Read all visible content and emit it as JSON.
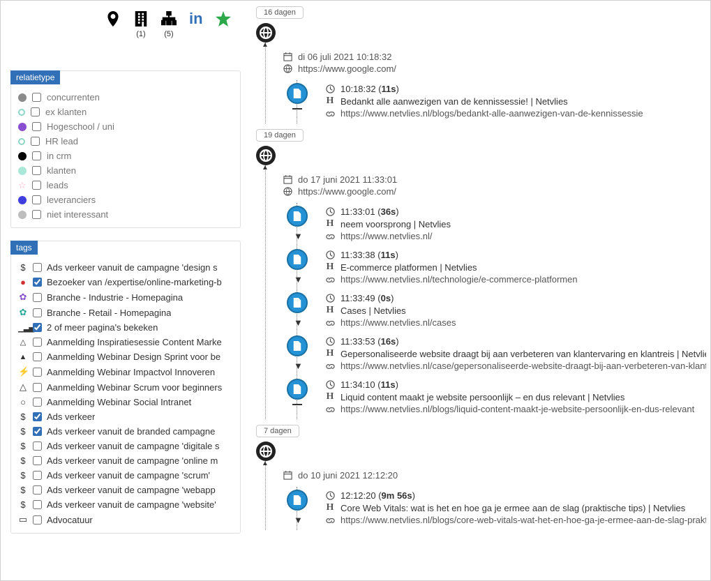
{
  "topIcons": {
    "marker": "",
    "building": {
      "count": "(1)"
    },
    "sitemap": {
      "count": "(5)"
    },
    "linkedin": "",
    "star": ""
  },
  "panels": {
    "relatietype": {
      "title": "relatietype",
      "items": [
        {
          "color": "#8a8a8a",
          "style": "solid",
          "label": "concurrenten"
        },
        {
          "color": "#8ed6c6",
          "style": "open",
          "label": "ex klanten"
        },
        {
          "color": "#8a4fd0",
          "style": "solid",
          "label": "Hogeschool / uni"
        },
        {
          "color": "#8ed6c6",
          "style": "open",
          "label": "HR lead"
        },
        {
          "color": "#000000",
          "style": "solid",
          "label": "in crm"
        },
        {
          "color": "#a9e8d8",
          "style": "solid",
          "label": "klanten"
        },
        {
          "color": "",
          "style": "star",
          "label": "leads"
        },
        {
          "color": "#3f3fe0",
          "style": "solid",
          "label": "leveranciers"
        },
        {
          "color": "#bdbdbd",
          "style": "solid",
          "label": "niet interessant"
        }
      ]
    },
    "tags": {
      "title": "tags",
      "items": [
        {
          "icon": "dollar",
          "checked": false,
          "label": "Ads verkeer vanuit de campagne 'design s"
        },
        {
          "icon": "reddot",
          "checked": true,
          "label": "Bezoeker van /expertise/online-marketing-b"
        },
        {
          "icon": "cogs-purple",
          "checked": false,
          "label": "Branche - Industrie - Homepagina"
        },
        {
          "icon": "cogs-teal",
          "checked": false,
          "label": "Branche - Retail - Homepagina"
        },
        {
          "icon": "chart",
          "checked": true,
          "label": "2 of meer pagina's bekeken"
        },
        {
          "icon": "bell-open",
          "checked": false,
          "label": "Aanmelding Inspiratiesessie Content Marke"
        },
        {
          "icon": "bell",
          "checked": false,
          "label": "Aanmelding Webinar Design Sprint voor be"
        },
        {
          "icon": "bolt",
          "checked": false,
          "label": "Aanmelding Webinar Impactvol Innoveren"
        },
        {
          "icon": "triangle",
          "checked": false,
          "label": "Aanmelding Webinar Scrum voor beginners"
        },
        {
          "icon": "circle-open",
          "checked": false,
          "label": "Aanmelding Webinar Social Intranet"
        },
        {
          "icon": "dollar",
          "checked": true,
          "label": "Ads verkeer"
        },
        {
          "icon": "dollar",
          "checked": true,
          "label": "Ads verkeer vanuit de branded campagne"
        },
        {
          "icon": "dollar",
          "checked": false,
          "label": "Ads verkeer vanuit de campagne 'digitale s"
        },
        {
          "icon": "dollar",
          "checked": false,
          "label": "Ads verkeer vanuit de campagne 'online m"
        },
        {
          "icon": "dollar",
          "checked": false,
          "label": "Ads verkeer vanuit de campagne 'scrum'"
        },
        {
          "icon": "dollar",
          "checked": false,
          "label": "Ads verkeer vanuit de campagne 'webapp"
        },
        {
          "icon": "dollar",
          "checked": false,
          "label": "Ads verkeer vanuit de campagne 'website'"
        },
        {
          "icon": "book",
          "checked": false,
          "label": "Advocatuur"
        }
      ]
    }
  },
  "timeline": [
    {
      "daysAgo": "16 dagen",
      "sourceDate": "di 06 juli 2021 10:18:32",
      "sourceUrl": "https://www.google.com/",
      "visits": [
        {
          "time": "10:18:32",
          "duration": "11s",
          "title": "Bedankt alle aanwezigen van de kennissessie! | Netvlies",
          "url": "https://www.netvlies.nl/blogs/bedankt-alle-aanwezigen-van-de-kennissessie",
          "last": true
        }
      ]
    },
    {
      "daysAgo": "19 dagen",
      "sourceDate": "do 17 juni 2021 11:33:01",
      "sourceUrl": "https://www.google.com/",
      "visits": [
        {
          "time": "11:33:01",
          "duration": "36s",
          "title": "neem voorsprong | Netvlies",
          "url": "https://www.netvlies.nl/"
        },
        {
          "time": "11:33:38",
          "duration": "11s",
          "title": "E-commerce platformen | Netvlies",
          "url": "https://www.netvlies.nl/technologie/e-commerce-platformen"
        },
        {
          "time": "11:33:49",
          "duration": "0s",
          "title": "Cases | Netvlies",
          "url": "https://www.netvlies.nl/cases"
        },
        {
          "time": "11:33:53",
          "duration": "16s",
          "title": "Gepersonaliseerde website draagt bij aan verbeteren van klantervaring en klantreis | Netvlies",
          "url": "https://www.netvlies.nl/case/gepersonaliseerde-website-draagt-bij-aan-verbeteren-van-klantervarin"
        },
        {
          "time": "11:34:10",
          "duration": "11s",
          "title": "Liquid content maakt je website persoonlijk – en dus relevant | Netvlies",
          "url": "https://www.netvlies.nl/blogs/liquid-content-maakt-je-website-persoonlijk-en-dus-relevant",
          "last": true
        }
      ]
    },
    {
      "daysAgo": "7 dagen",
      "sourceDate": "do 10 juni 2021 12:12:20",
      "sourceUrl": "",
      "visits": [
        {
          "time": "12:12:20",
          "duration": "9m 56s",
          "title": "Core Web Vitals: wat is het en hoe ga je ermee aan de slag (praktische tips) | Netvlies",
          "url": "https://www.netvlies.nl/blogs/core-web-vitals-wat-het-en-hoe-ga-je-ermee-aan-de-slag-praktische-t"
        }
      ]
    }
  ]
}
